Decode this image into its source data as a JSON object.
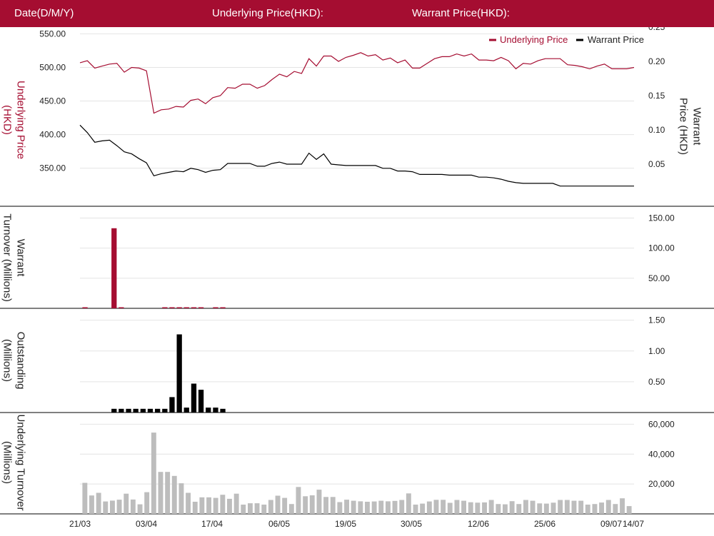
{
  "header": {
    "date_label": "Date(D/M/Y)",
    "underlying_label": "Underlying Price(HKD):",
    "warrant_label": "Warrant Price(HKD):"
  },
  "colors": {
    "brand": "#a50d31",
    "underlying": "#a50d31",
    "warrant": "#000000",
    "outstanding": "#000000",
    "underlying_turnover": "#bdbdbd"
  },
  "chart_data": [
    {
      "type": "line",
      "title": "",
      "legend": {
        "placement": "top-right",
        "entries": [
          "Underlying Price",
          "Warrant Price"
        ]
      },
      "ylabel_left": "Underlying Price (HKD)",
      "ylabel_right": "Warrant  Price (HKD)",
      "y_left_ticks": [
        "550.00",
        "500.00",
        "450.00",
        "400.00",
        "350.00"
      ],
      "y_right_ticks": [
        "0.25",
        "0.20",
        "0.15",
        "0.10",
        "0.05"
      ],
      "y_left_range": [
        305,
        560
      ],
      "y_right_range": [
        0,
        0.25
      ],
      "grid": true,
      "series": [
        {
          "name": "Underlying Price",
          "axis": "left",
          "values": [
            507,
            510,
            499,
            502,
            505,
            506,
            493,
            500,
            499,
            495,
            432,
            437,
            438,
            442,
            441,
            451,
            453,
            446,
            455,
            458,
            470,
            469,
            475,
            475,
            469,
            473,
            482,
            490,
            486,
            494,
            491,
            513,
            502,
            517,
            517,
            509,
            515,
            518,
            522,
            517,
            519,
            511,
            514,
            507,
            511,
            499,
            499,
            506,
            513,
            516,
            516,
            520,
            517,
            520,
            511,
            511,
            510,
            515,
            510,
            498,
            506,
            505,
            510,
            513,
            513,
            513,
            504,
            503,
            501,
            498,
            502,
            505,
            498,
            498,
            498,
            500
          ]
        },
        {
          "name": "Warrant Price",
          "axis": "right",
          "values": [
            0.107,
            0.096,
            0.082,
            0.084,
            0.085,
            0.077,
            0.068,
            0.065,
            0.058,
            0.052,
            0.033,
            0.036,
            0.038,
            0.04,
            0.039,
            0.044,
            0.042,
            0.038,
            0.041,
            0.042,
            0.051,
            0.051,
            0.051,
            0.051,
            0.047,
            0.047,
            0.051,
            0.053,
            0.05,
            0.05,
            0.05,
            0.066,
            0.057,
            0.065,
            0.05,
            0.049,
            0.048,
            0.048,
            0.048,
            0.048,
            0.048,
            0.044,
            0.044,
            0.04,
            0.04,
            0.039,
            0.035,
            0.035,
            0.035,
            0.035,
            0.034,
            0.034,
            0.034,
            0.034,
            0.031,
            0.031,
            0.03,
            0.028,
            0.025,
            0.023,
            0.022,
            0.022,
            0.022,
            0.022,
            0.022,
            0.018,
            0.018,
            0.018,
            0.018,
            0.018,
            0.018,
            0.018,
            0.018,
            0.018,
            0.018,
            0.018
          ]
        }
      ]
    },
    {
      "type": "bar",
      "ylabel": "Warrant  Turnover (Millions)",
      "y_ticks": [
        "150.00",
        "100.00",
        "50.00"
      ],
      "y_range": [
        0,
        160
      ],
      "grid": true,
      "series": [
        {
          "values": [
            1,
            0,
            0,
            0,
            133,
            1,
            0,
            0,
            0,
            0,
            0,
            1,
            1,
            1,
            1,
            1,
            1,
            0,
            1,
            1,
            0,
            0,
            0,
            0,
            0,
            0,
            0,
            0,
            0,
            0,
            0,
            0,
            0,
            0,
            0,
            0,
            0,
            0,
            0,
            0,
            0,
            0,
            0,
            0,
            0,
            0,
            0,
            0,
            0,
            0,
            0,
            0,
            0,
            0,
            0,
            0,
            0,
            0,
            0,
            0,
            0,
            0,
            0,
            0,
            0,
            0,
            0,
            0,
            0,
            0,
            0,
            0,
            0,
            0,
            0,
            0
          ]
        }
      ]
    },
    {
      "type": "bar",
      "ylabel": "Outstanding (Millions)",
      "y_ticks": [
        "1.50",
        "1.00",
        "0.50"
      ],
      "y_range": [
        0,
        1.6
      ],
      "grid": true,
      "series": [
        {
          "values": [
            0,
            0,
            0,
            0,
            0.06,
            0.06,
            0.06,
            0.06,
            0.06,
            0.06,
            0.06,
            0.06,
            0.25,
            1.27,
            0.08,
            0.47,
            0.37,
            0.08,
            0.08,
            0.06,
            0,
            0,
            0,
            0,
            0,
            0,
            0,
            0,
            0,
            0,
            0,
            0,
            0,
            0,
            0,
            0,
            0,
            0,
            0,
            0,
            0,
            0,
            0,
            0,
            0,
            0,
            0,
            0,
            0,
            0,
            0,
            0,
            0,
            0,
            0,
            0,
            0,
            0,
            0,
            0,
            0,
            0,
            0,
            0,
            0,
            0,
            0,
            0,
            0,
            0,
            0,
            0,
            0,
            0,
            0,
            0
          ]
        }
      ]
    },
    {
      "type": "bar",
      "ylabel": "Underlying Turnover (Millions)",
      "y_ticks": [
        "60,000",
        "40,000",
        "20,000"
      ],
      "y_range": [
        0,
        64000
      ],
      "grid": true,
      "x_tick_labels": [
        "21/03",
        "03/04",
        "17/04",
        "06/05",
        "19/05",
        "30/05",
        "12/06",
        "25/06",
        "09/07",
        "14/07"
      ],
      "series": [
        {
          "values": [
            20800,
            12300,
            14100,
            8300,
            8900,
            9500,
            13500,
            9600,
            6400,
            14500,
            54400,
            28100,
            28100,
            25400,
            20500,
            14100,
            8100,
            11100,
            11100,
            10700,
            12800,
            10100,
            13500,
            6200,
            7100,
            7100,
            6200,
            9300,
            12200,
            10700,
            6600,
            18000,
            11800,
            12400,
            16200,
            11300,
            11300,
            7900,
            9500,
            8800,
            8400,
            8100,
            8300,
            8800,
            8400,
            8700,
            9300,
            13700,
            6200,
            6900,
            8300,
            9400,
            9400,
            7400,
            9300,
            8800,
            7800,
            7500,
            7700,
            9300,
            6600,
            6400,
            8500,
            6600,
            9300,
            8800,
            7000,
            6900,
            7500,
            9300,
            9300,
            8800,
            8800,
            6200,
            6600,
            7600,
            9300,
            6600,
            10400,
            5200
          ]
        }
      ]
    }
  ]
}
